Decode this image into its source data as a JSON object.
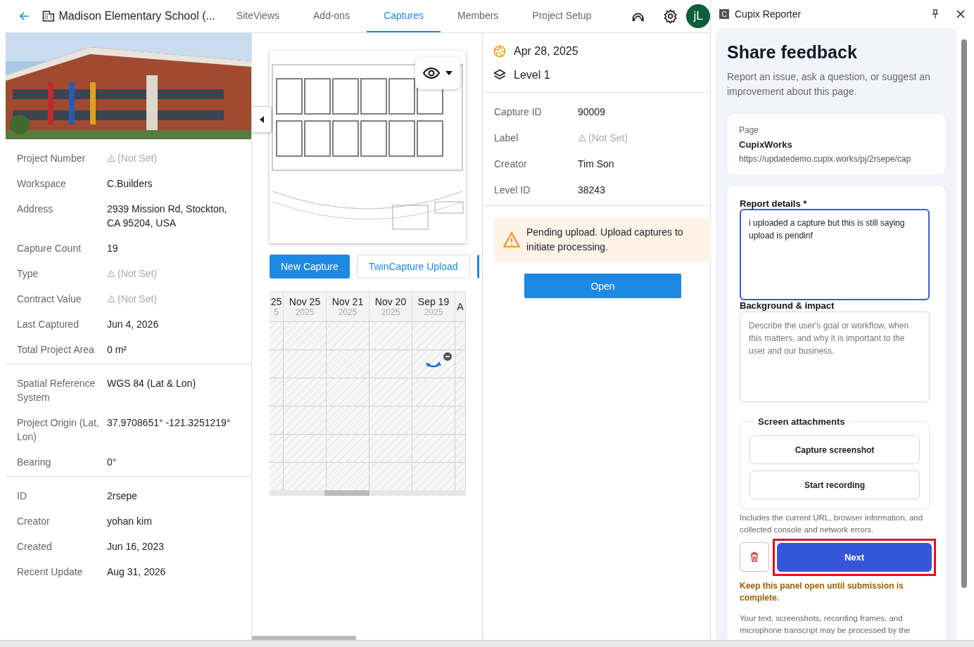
{
  "header": {
    "title": "Madison Elementary School (...",
    "avatar": "jL",
    "tabs": [
      {
        "label": "SiteViews",
        "selected": false
      },
      {
        "label": "Add-ons",
        "selected": false
      },
      {
        "label": "Captures",
        "selected": true
      },
      {
        "label": "Members",
        "selected": false
      },
      {
        "label": "Project Setup",
        "selected": false
      }
    ]
  },
  "project": {
    "photo": {
      "kind": "picture"
    },
    "sections": [
      [
        {
          "label": "Project Number",
          "value": "(Not Set)",
          "kind": "not_set"
        },
        {
          "label": "Workspace",
          "value": "C.Builders",
          "kind": "text"
        },
        {
          "label": "Address",
          "value": "2939 Mission Rd, Stockton, CA 95204, USA",
          "kind": "text"
        },
        {
          "label": "Capture Count",
          "value": "19",
          "kind": "text"
        },
        {
          "label": "Type",
          "value": "(Not Set)",
          "kind": "not_set"
        },
        {
          "label": "Contract Value",
          "value": "(Not Set)",
          "kind": "not_set"
        },
        {
          "label": "Last Captured",
          "value": "Jun 4, 2026",
          "kind": "text"
        },
        {
          "label": "Total Project Area",
          "value": "0 m²",
          "kind": "text"
        }
      ],
      [
        {
          "label": "Spatial Reference System",
          "value": "WGS 84 (Lat & Lon)",
          "kind": "text"
        },
        {
          "label": "Project Origin (Lat, Lon)",
          "value": "37.9708651° -121.3251219°",
          "kind": "text"
        },
        {
          "label": "Bearing",
          "value": "0°",
          "kind": "text"
        }
      ],
      [
        {
          "label": "ID",
          "value": "2rsepe",
          "kind": "text"
        },
        {
          "label": "Creator",
          "value": "yohan kim",
          "kind": "text"
        },
        {
          "label": "Created",
          "value": "Jun 16, 2023",
          "kind": "text"
        },
        {
          "label": "Recent Update",
          "value": "Aug 31, 2026",
          "kind": "text"
        }
      ]
    ]
  },
  "captures": {
    "plan": {
      "kind": "picture"
    },
    "buttons": [
      {
        "label": "New Capture",
        "kind": "primary"
      },
      {
        "label": "TwinCapture Upload",
        "kind": "outline"
      }
    ],
    "timeline": {
      "columns": [
        {
          "date": "25",
          "year": "5"
        },
        {
          "date": "Nov 25",
          "year": "2025"
        },
        {
          "date": "Nov 21",
          "year": "2025"
        },
        {
          "date": "Nov 20",
          "year": "2025"
        },
        {
          "date": "Sep 19",
          "year": "2025"
        },
        {
          "date": "A"
        }
      ],
      "rows": [
        [
          false,
          false,
          false,
          false,
          false,
          false
        ],
        [
          false,
          false,
          false,
          false,
          true,
          false
        ],
        [
          false,
          false,
          false,
          false,
          false,
          false
        ],
        [
          false,
          false,
          false,
          false,
          false,
          false
        ],
        [
          false,
          false,
          false,
          false,
          false,
          false
        ],
        [
          false,
          false,
          false,
          false,
          false,
          false
        ]
      ]
    }
  },
  "details": {
    "date": "Apr 28, 2025",
    "level": "Level 1",
    "fields": [
      {
        "label": "Capture ID",
        "value": "90009",
        "kind": "text"
      },
      {
        "label": "Label",
        "value": "(Not Set)",
        "kind": "not_set"
      },
      {
        "label": "Creator",
        "value": "Tim Son",
        "kind": "text"
      },
      {
        "label": "Level ID",
        "value": "38243",
        "kind": "text"
      }
    ],
    "alert": "Pending upload. Upload captures to initiate processing.",
    "open_button": "Open"
  },
  "reporter": {
    "title": "Cupix Reporter",
    "logo": "C",
    "heading": "Share feedback",
    "intro": "Report an issue, ask a question, or suggest an improvement about this page.",
    "page": {
      "label": "Page",
      "name": "CupixWorks",
      "url": "https://updatedemo.cupix.works/pj/2rsepe/cap"
    },
    "details_label": "Report details *",
    "details_value": "i uploaded a capture but this is still saying upload is pendinf",
    "background_label": "Background & impact",
    "background_placeholder": "Describe the user's goal or workflow, when this matters, and why it is important to the user and our business.",
    "attachments": {
      "legend": "Screen attachments",
      "buttons": [
        "Capture screenshot",
        "Start recording"
      ]
    },
    "note": "Includes the current URL, browser information, and collected console and network errors.",
    "next": {
      "label": "Next",
      "highlighted": true
    },
    "warning": "Keep this panel open until submission is complete.",
    "privacy": "Your text, screenshots, recording frames, and microphone transcript may be processed by the"
  }
}
